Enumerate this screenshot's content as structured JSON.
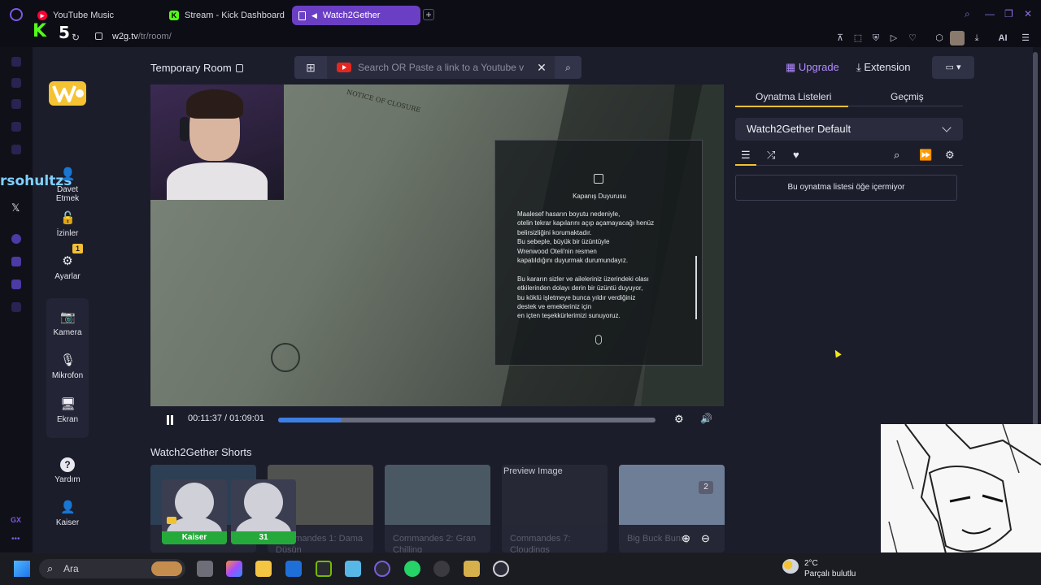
{
  "browser": {
    "tabs": [
      {
        "label": "YouTube Music",
        "icon": "youtube-music-icon"
      },
      {
        "label": "Stream - Kick Dashboard",
        "icon": "kick-icon"
      },
      {
        "label": "Watch2Gether",
        "icon": "page-icon",
        "active": true
      }
    ],
    "new_tab_label": "+",
    "url_host": "w2g.tv",
    "url_path": "/tr/room/",
    "ai_label": "AI"
  },
  "stream_overlay": {
    "k_label": "K",
    "count": "5",
    "username_fragment": "rsohultzs"
  },
  "sidebar": {
    "items": [
      {
        "label": "Davet Etmek",
        "icon": "add-user-icon"
      },
      {
        "label": "İzinler",
        "icon": "lock-icon"
      },
      {
        "label": "Ayarlar",
        "icon": "gear-icon",
        "badge": "1"
      },
      {
        "label": "Kamera",
        "icon": "camera-icon"
      },
      {
        "label": "Mikrofon",
        "icon": "microphone-icon"
      },
      {
        "label": "Ekran",
        "icon": "monitor-icon"
      },
      {
        "label": "Yardım",
        "icon": "help-icon"
      },
      {
        "label": "Kaiser",
        "icon": "user-icon"
      }
    ]
  },
  "header": {
    "room_title": "Temporary Room",
    "search_placeholder": "Search OR Paste a link to a Youtube vid",
    "upgrade_label": "Upgrade",
    "extension_label": "Extension"
  },
  "video": {
    "closure_title": "Kapanış Duyurusu",
    "closure_lines": [
      "Maalesef hasarın boyutu nedeniyle,",
      "otelin tekrar kapılarını açıp açamayacağı henüz",
      "belirsizliğini korumaktadır.",
      "Bu sebeple, büyük bir üzüntüyle",
      "Wrenwood Oteli'nin resmen",
      "kapatıldığını duyurmak durumundayız.",
      "",
      "Bu kararın sizler ve aileleriniz üzerindeki olası",
      "etkilerinden dolayı derin bir üzüntü duyuyor,",
      "bu köklü işletmeye bunca yıldır verdiğiniz",
      "destek ve emekleriniz için",
      "en içten teşekkürlerimizi sunuyoruz."
    ],
    "paper_heading": "NOTICE OF CLOSURE",
    "time_display": "00:11:37 / 01:09:01",
    "progress": 0.168
  },
  "shorts": {
    "title": "Watch2Gether Shorts",
    "items": [
      {
        "caption": "",
        "color": "#2c3f55"
      },
      {
        "caption": "Commandes 1: Dama Düşün",
        "color": "#505250"
      },
      {
        "caption": "Commandes 2: Gran Chilling",
        "color": "#4a5863"
      },
      {
        "caption": "Commandes 7: Cloudings",
        "color": "#262836",
        "alt": "Preview Image"
      },
      {
        "caption": "Big Buck Bunny",
        "color": "#6e7e96",
        "badge": "2"
      }
    ],
    "users": [
      {
        "name": "Kaiser",
        "host": true
      },
      {
        "name": "31",
        "host": false
      }
    ]
  },
  "playlist": {
    "tabs": [
      "Oynatma Listeleri",
      "Geçmiş"
    ],
    "selected": "Watch2Gether Default",
    "empty_message": "Bu oynatma listesi öğe içermiyor"
  },
  "taskbar": {
    "search_label": "Ara",
    "weather_temp": "2°C",
    "weather_desc": "Parçalı bulutlu"
  },
  "colors": {
    "accent": "#6b3fc4",
    "upgrade": "#b18bff",
    "tab_underline": "#f2c036",
    "progress_fill": "#3f7ee3",
    "user_badge": "#26a93b",
    "kick_green": "#53fc18"
  }
}
